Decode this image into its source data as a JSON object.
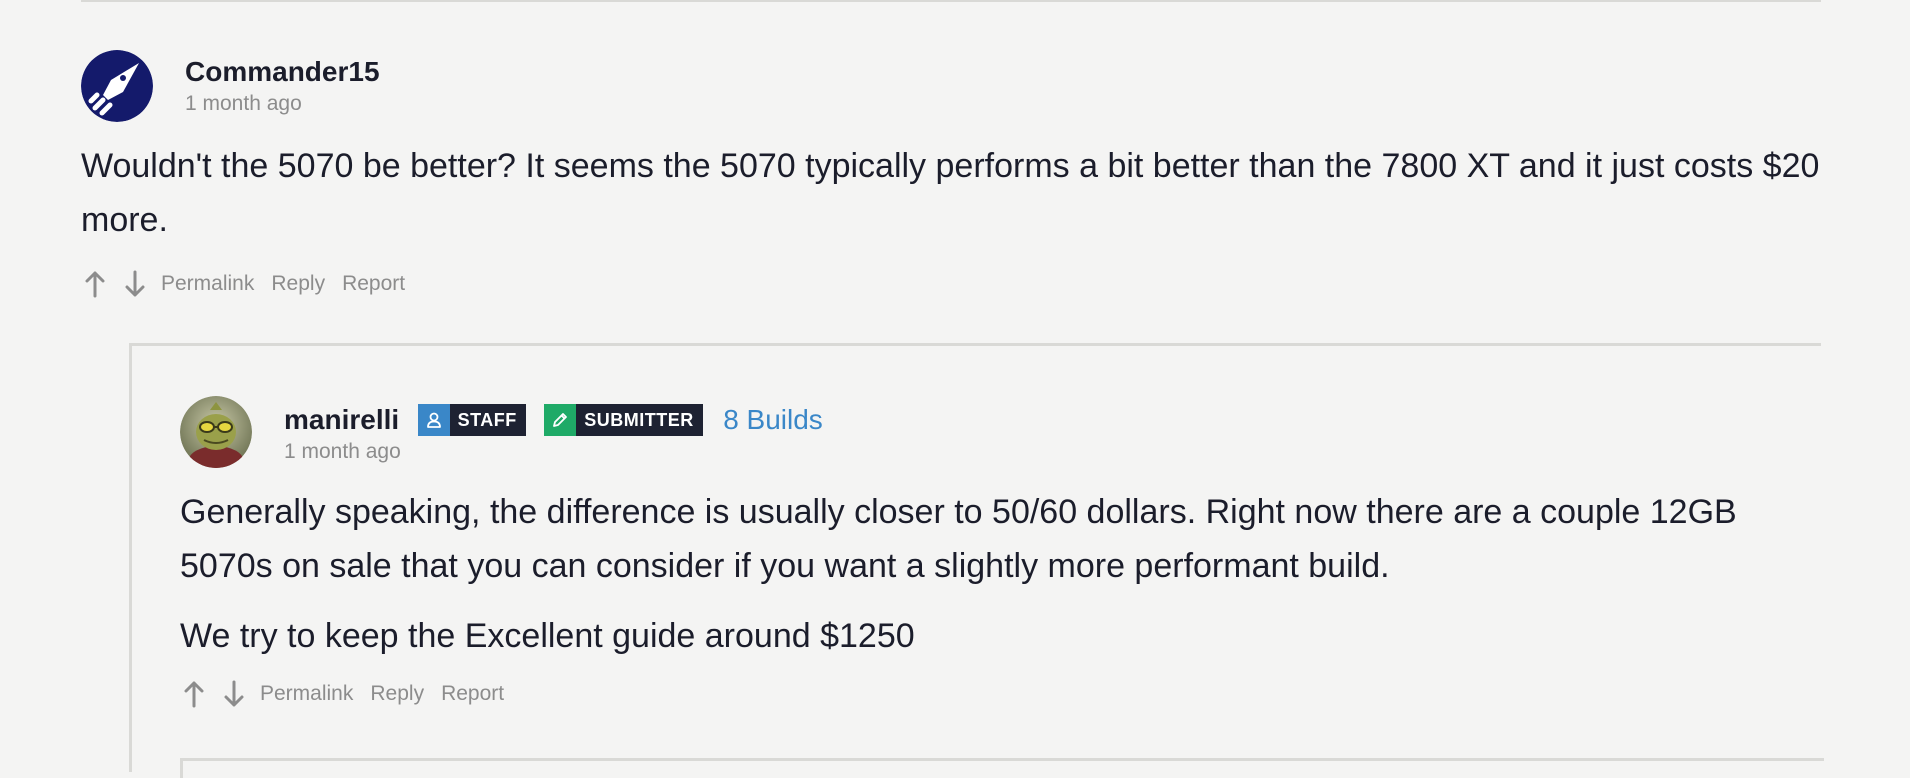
{
  "comments": [
    {
      "username": "Commander15",
      "timestamp": "1 month ago",
      "avatar_icon": "rocket-logo-icon",
      "paragraphs": [
        "Wouldn't the 5070 be better? It seems the 5070 typically performs a bit better than the 7800 XT and it just costs $20 more."
      ],
      "actions": {
        "permalink": "Permalink",
        "reply": "Reply",
        "report": "Report"
      }
    },
    {
      "username": "manirelli",
      "timestamp": "1 month ago",
      "avatar_icon": "user-avatar-photo",
      "badges": [
        {
          "label": "STAFF",
          "icon": "user-icon",
          "color": "#3a87c8"
        },
        {
          "label": "SUBMITTER",
          "icon": "pencil-icon",
          "color": "#1faa67"
        }
      ],
      "builds_link": "8 Builds",
      "paragraphs": [
        "Generally speaking, the difference is usually closer to 50/60 dollars. Right now there are a couple 12GB 5070s on sale that you can consider if you want a slightly more performant build.",
        "We try to keep the Excellent guide around $1250"
      ],
      "actions": {
        "permalink": "Permalink",
        "reply": "Reply",
        "report": "Report"
      }
    }
  ],
  "colors": {
    "background": "#f4f4f3",
    "text": "#1b1d2b",
    "muted": "#8c8c8c",
    "link": "#3a87c8",
    "badge_dark": "#1e2232",
    "staff_accent": "#3a87c8",
    "submitter_accent": "#1faa67",
    "divider": "#d9d9d6"
  }
}
